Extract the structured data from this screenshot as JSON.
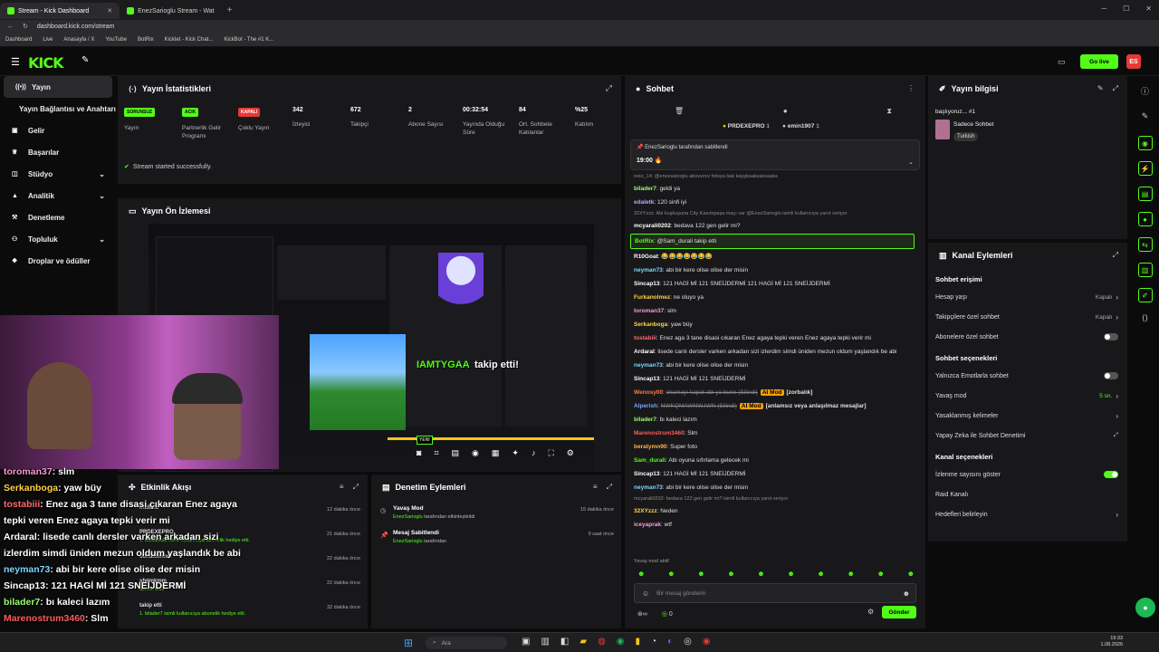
{
  "browser": {
    "tabs": [
      {
        "label": "Stream - Kick Dashboard",
        "active": true
      },
      {
        "label": "EnezSarioglu Stream - Wat",
        "active": false
      }
    ],
    "url": "dashboard.kick.com/stream",
    "bookmarks": [
      "Dashboard",
      "Live",
      "Anasayfa / X",
      "YouTube",
      "BotRix",
      "Kicklet - Kick Chat...",
      "KickBot - The #1 K..."
    ]
  },
  "nav": {
    "logo": "KICK",
    "go_live_label": "Go live",
    "accent": "#53fc18"
  },
  "sidebar": {
    "items": [
      {
        "label": "Yayın",
        "icon": "broadcast-icon",
        "active": true
      },
      {
        "label": "Yayın Bağlantısı ve Anahtarı",
        "icon": "",
        "active": false
      },
      {
        "label": "Gelir",
        "icon": "wallet-icon",
        "active": false
      },
      {
        "label": "Başarılar",
        "icon": "trophy-icon",
        "active": false
      },
      {
        "label": "Stüdyo",
        "icon": "studio-icon",
        "active": false,
        "chevron": true
      },
      {
        "label": "Analitik",
        "icon": "analytics-icon",
        "active": false,
        "chevron": true
      },
      {
        "label": "Denetleme",
        "icon": "gavel-icon",
        "active": false
      },
      {
        "label": "Topluluk",
        "icon": "community-icon",
        "active": false,
        "chevron": true
      },
      {
        "label": "Droplar ve ödüller",
        "icon": "gift-icon",
        "active": false
      }
    ]
  },
  "stats": {
    "title": "Yayın İstatistikleri",
    "items": [
      {
        "value": "SORUNSUZ",
        "label": "Yayın",
        "badge": "green"
      },
      {
        "value": "ACIK",
        "label": "Partnerlik Gelir Programı",
        "badge": "green"
      },
      {
        "value": "KAPALI",
        "label": "Çoklu Yayın",
        "badge": "red"
      },
      {
        "value": "342",
        "label": "İzleyici"
      },
      {
        "value": "672",
        "label": "Takipçi"
      },
      {
        "value": "2",
        "label": "Abone Sayısı"
      },
      {
        "value": "00:32:54",
        "label": "Yayında Olduğu Süre"
      },
      {
        "value": "84",
        "label": "Ort. Sohbete Katılanlar"
      },
      {
        "value": "%25",
        "label": "Katılım"
      }
    ],
    "success_message": "Stream started successfully."
  },
  "preview": {
    "title": "Yayın Ön İzlemesi",
    "follow_overlay": "IAMTYGAA",
    "follow_text": "takip etti!",
    "new_badge": "YENİ"
  },
  "stream_overlay_chat": [
    {
      "user": "toroman37",
      "text": "slm",
      "color": "#ff9bd3"
    },
    {
      "user": "Serkanboga",
      "text": "yaw büy",
      "color": "#ffd24a"
    },
    {
      "user": "tostabiii",
      "text": "Enez aga 3 tane disasi çıkaran Enez agaya",
      "color": "#ff6b6b"
    },
    {
      "user": "",
      "text": "tepki veren Enez agaya tepki verir mi",
      "color": ""
    },
    {
      "user": "Ardaral",
      "text": "lisede canlı dersler varken arkadan sizi",
      "color": "#ffffff"
    },
    {
      "user": "",
      "text": "izlerdim simdi üniden mezun oldum yaşlandık be abi",
      "color": ""
    },
    {
      "user": "neyman73",
      "text": "abi bir kere olise olise der misin",
      "color": "#7ad7ff"
    },
    {
      "user": "Sincap13",
      "text": "121 HAGİ Mİ 121 SNEİJDERMİ",
      "color": "#ffffff"
    },
    {
      "user": "bilader7",
      "text": "bı kaleci lazım",
      "color": "#9cff6b"
    },
    {
      "user": "Marenostrum3460",
      "text": "Slm",
      "color": "#ff5b5b"
    }
  ],
  "activity": {
    "title": "Etkinlik Akışı",
    "items": [
      {
        "name": "maflica",
        "desc": "",
        "time": "12 dakika önce"
      },
      {
        "name": "PRDEXEPRO",
        "desc": "1. bulkanisla isimli kullanıcıya abonelik hediye etti.",
        "time": "21 dakika önce"
      },
      {
        "name": "donaldennm",
        "desc": "",
        "time": "22 dakika önce"
      },
      {
        "name": "sfetmkmm",
        "desc": "abone oldu",
        "time": "22 dakika önce"
      },
      {
        "name": "takip etti",
        "desc": "1. bilader7 isimli kullanıcıya abonelik hediye etti.",
        "time": "32 dakika önce"
      }
    ]
  },
  "moderation": {
    "title": "Denetim Eylemleri",
    "items": [
      {
        "title": "Yavaş Mod",
        "by": "EnezSarioglu",
        "desc": "tarafından etkinleştirildi",
        "time": "15 dakika önce"
      },
      {
        "title": "Mesaj Sabitlendi",
        "by": "EnezSarioglu",
        "desc": "tarafından",
        "time": "9 saat önce"
      }
    ]
  },
  "chat": {
    "title": "Sohbet",
    "top_gifters": [
      {
        "name": "PRDEXEPRO",
        "count": "1"
      },
      {
        "name": "emin1907",
        "count": "1"
      }
    ],
    "pinned_by": "EnezSarioglu tarafından sabitlendi",
    "pinned_text": "19:00 🔥",
    "messages": [
      {
        "user": "",
        "text": "reso_14: @enezsarioglu abovvvvv fotoya bak kaşşkaaksaksaaka",
        "color": "#888",
        "system": true
      },
      {
        "user": "bilader7",
        "text": "geldi ya",
        "color": "#9cff6b"
      },
      {
        "user": "edaletk",
        "text": "120 sinfi iyi",
        "color": "#bfa3ff"
      },
      {
        "user": "",
        "text": "32XYzzz: Abi kuşkuşuna City Kasımpaşa maçı var @EnezSarioglu isimli kullanıcıya yanıt veriyor",
        "color": "#888",
        "system": true
      },
      {
        "user": "mcyarali0202",
        "text": "bedava 122 gen gelir mi?",
        "color": "#ffffff"
      },
      {
        "user": "BotRix",
        "text": "@Sam_durali takip etti",
        "color": "#53fc18",
        "highlight": true
      },
      {
        "user": "R10Goat",
        "text": "😂😂😂😂😂😂😂",
        "color": "#ffffff"
      },
      {
        "user": "neyman73",
        "text": "abi bir kere olise olise der misin",
        "color": "#7ad7ff"
      },
      {
        "user": "Sincap13",
        "text": "121 HAGİ Mİ 121 SNEİJDERMİ 121 HAGİ Mİ 121 SNEİJDERMİ",
        "color": "#ffffff"
      },
      {
        "user": "Furkanolmez",
        "text": "ne oluyo ya",
        "color": "#ffd24a"
      },
      {
        "user": "toroman37",
        "text": "slm",
        "color": "#ff9bd3"
      },
      {
        "user": "Serkanboga",
        "text": "yaw büy",
        "color": "#ffd24a"
      },
      {
        "user": "tostabiii",
        "text": "Enez aga 3 tane disasi cıkaran Enez agaya tepki veren Enez agaya tepki verir mi",
        "color": "#ff6b6b"
      },
      {
        "user": "Ardaral",
        "text": "lisede canlı dersler varken arkadan sizi izlerdim simdi üniden mezun oldum yaşlandık be abi",
        "color": "#ffffff"
      },
      {
        "user": "neyman73",
        "text": "abi bir kere olise olise der misin",
        "color": "#7ad7ff"
      },
      {
        "user": "Sincap13",
        "text": "121 HAGİ Mİ 121 SNEİJDERMİ",
        "color": "#ffffff"
      },
      {
        "user": "Wenosy00",
        "text": "okumayı kapat abi ya bune (Silindi)",
        "color": "#ff7a45",
        "deleted": true,
        "tag": "AI Mod",
        "tag2": "[zorbalık]"
      },
      {
        "user": "Alperish",
        "text": "NWKQMAWNW.IWN (Silindi)",
        "color": "#7aa8ff",
        "deleted": true,
        "tag": "AI Mod",
        "tag2": "[anlamsız veya anlaşılmaz mesajlar]"
      },
      {
        "user": "bilader7",
        "text": "bı kaleci lazım",
        "color": "#9cff6b"
      },
      {
        "user": "Marenostrum3460",
        "text": "Slm",
        "color": "#ff5b5b"
      },
      {
        "user": "beratymn90",
        "text": "Super foto",
        "color": "#ffb347"
      },
      {
        "user": "Sam_durali",
        "text": "Abi oyuna sıfırlama gelecek mi",
        "color": "#53fc18"
      },
      {
        "user": "Sincap13",
        "text": "121 HAGİ Mİ 121 SNEİJDERMİ",
        "color": "#ffffff"
      },
      {
        "user": "neyman73",
        "text": "abi bir kere olise olise der misin",
        "color": "#7ad7ff"
      },
      {
        "user": "",
        "text": "mcyarali0202: bedava 122 gen gelir mi? isimli kullanıcıya yanıt veriyor",
        "color": "#888",
        "system": true
      },
      {
        "user": "32XYzzz",
        "text": "Neden",
        "color": "#ffd24a"
      },
      {
        "user": "iceyaprak",
        "text": "wtf",
        "color": "#ff9bd3"
      }
    ],
    "slow_mode_notice": "Yavaş mod aktif",
    "input_placeholder": "Bir mesaj gönderin",
    "points": "0",
    "send_label": "Gönder"
  },
  "stream_info": {
    "title": "Yayın bilgisi",
    "stream_title": "başlıyoruz... #1",
    "category": "Sadece Sohbet",
    "tag": "Turkish"
  },
  "channel_actions": {
    "title": "Kanal Eylemleri",
    "chat_access_title": "Sohbet erişimi",
    "chat_access": [
      {
        "label": "Hesap yaşı",
        "value": "Kapalı",
        "type": "chevron"
      },
      {
        "label": "Takipçilere özel sohbet",
        "value": "Kapalı",
        "type": "chevron"
      },
      {
        "label": "Abonelere özel sohbet",
        "value": "",
        "type": "toggle",
        "on": false
      }
    ],
    "chat_options_title": "Sohbet seçenekleri",
    "chat_options": [
      {
        "label": "Yalnızca Emotlarla sohbet",
        "value": "",
        "type": "toggle",
        "on": false
      },
      {
        "label": "Yavaş mod",
        "value": "5 sn.",
        "type": "chevron"
      },
      {
        "label": "Yasaklanmış kelimeler",
        "value": "",
        "type": "chevron"
      },
      {
        "label": "Yapay Zeka ile Sohbet Denetimi",
        "value": "",
        "type": "external"
      }
    ],
    "channel_options_title": "Kanal seçenekleri",
    "channel_options": [
      {
        "label": "İzlenme sayısını göster",
        "value": "",
        "type": "toggle",
        "on": true
      },
      {
        "label": "Raid Kanalı",
        "value": "",
        "type": "none"
      },
      {
        "label": "Hedefleri belirleyin",
        "value": "",
        "type": "chevron"
      }
    ]
  },
  "taskbar": {
    "search_placeholder": "Ara",
    "time": "19:33",
    "date": "1.08.2026"
  }
}
